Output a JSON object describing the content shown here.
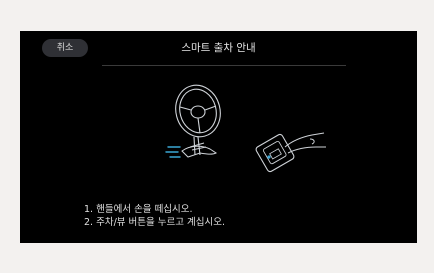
{
  "header": {
    "cancel_label": "취소",
    "title": "스마트 출차 안내"
  },
  "instructions": [
    "1. 핸들에서 손을 떼십시오.",
    "2. 주차/뷰 버튼을 누르고 계십시오."
  ],
  "colors": {
    "background": "#000000",
    "accent": "#3aa7d6",
    "line_art": "#cfd3d8"
  }
}
